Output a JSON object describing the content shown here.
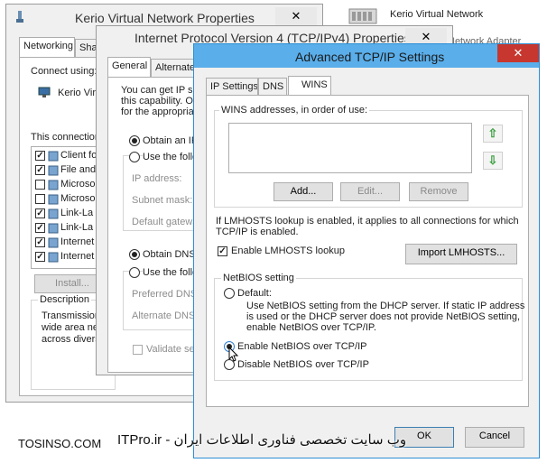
{
  "win1": {
    "title": "Kerio Virtual Network Properties",
    "close": "✕",
    "tabs": [
      "Networking",
      "Sha"
    ],
    "connect_using": "Connect using:",
    "adapter": "Kerio Virtu",
    "this_connection": "This connection",
    "items": [
      {
        "label": "Client fo",
        "checked": true
      },
      {
        "label": "File and",
        "checked": true
      },
      {
        "label": "Microso",
        "checked": false
      },
      {
        "label": "Microso",
        "checked": false
      },
      {
        "label": "Link-La",
        "checked": true
      },
      {
        "label": "Link-La",
        "checked": true
      },
      {
        "label": "Internet",
        "checked": true
      },
      {
        "label": "Internet",
        "checked": true
      }
    ],
    "install": "Install...",
    "description": "Description",
    "desc_lines": [
      "Transmission",
      "wide area net",
      "across diverse"
    ]
  },
  "win_back": {
    "title": "Kerio Virtual Network",
    "subtitle": "Network Adapter"
  },
  "win2": {
    "title": "Internet Protocol Version 4 (TCP/IPv4) Properties",
    "close": "✕",
    "tabs": [
      "General",
      "Alternate"
    ],
    "intro": [
      "You can get IP se",
      "this capability. Oth",
      "for the appropriat"
    ],
    "obtain_ip": "Obtain an IP",
    "use_following": "Use the follo",
    "ip_address": "IP address:",
    "subnet": "Subnet mask:",
    "gateway": "Default gatewa",
    "obtain_dns": "Obtain DNS s",
    "use_dns": "Use the follo",
    "preferred_dns": "Preferred DNS s",
    "alternate_dns": "Alternate DNS s",
    "validate": "Validate set"
  },
  "win3": {
    "title": "Advanced TCP/IP Settings",
    "close": "✕",
    "tabs": [
      "IP Settings",
      "DNS",
      "WINS"
    ],
    "wins_label": "WINS addresses, in order of use:",
    "up_arrow": "⇧",
    "down_arrow": "⇩",
    "add": "Add...",
    "edit": "Edit...",
    "remove": "Remove",
    "lmhosts_info": [
      "If LMHOSTS lookup is enabled, it applies to all connections for which",
      "TCP/IP is enabled."
    ],
    "enable_lmhosts": "Enable LMHOSTS lookup",
    "enable_lmhosts_checked": true,
    "import_lmhosts": "Import LMHOSTS...",
    "netbios_setting": "NetBIOS setting",
    "default": "Default:",
    "default_desc": [
      "Use NetBIOS setting from the DHCP server. If static IP address",
      "is used or the DHCP server does not provide NetBIOS setting,",
      "enable NetBIOS over TCP/IP."
    ],
    "enable_netbios": "Enable NetBIOS over TCP/IP",
    "disable_netbios": "Disable NetBIOS over TCP/IP",
    "ok": "OK",
    "cancel": "Cancel"
  },
  "watermark": {
    "left": "TOSINSO.COM",
    "right": "ITPro.ir - وب سایت تخصصی فناوری اطلاعات ایران"
  }
}
